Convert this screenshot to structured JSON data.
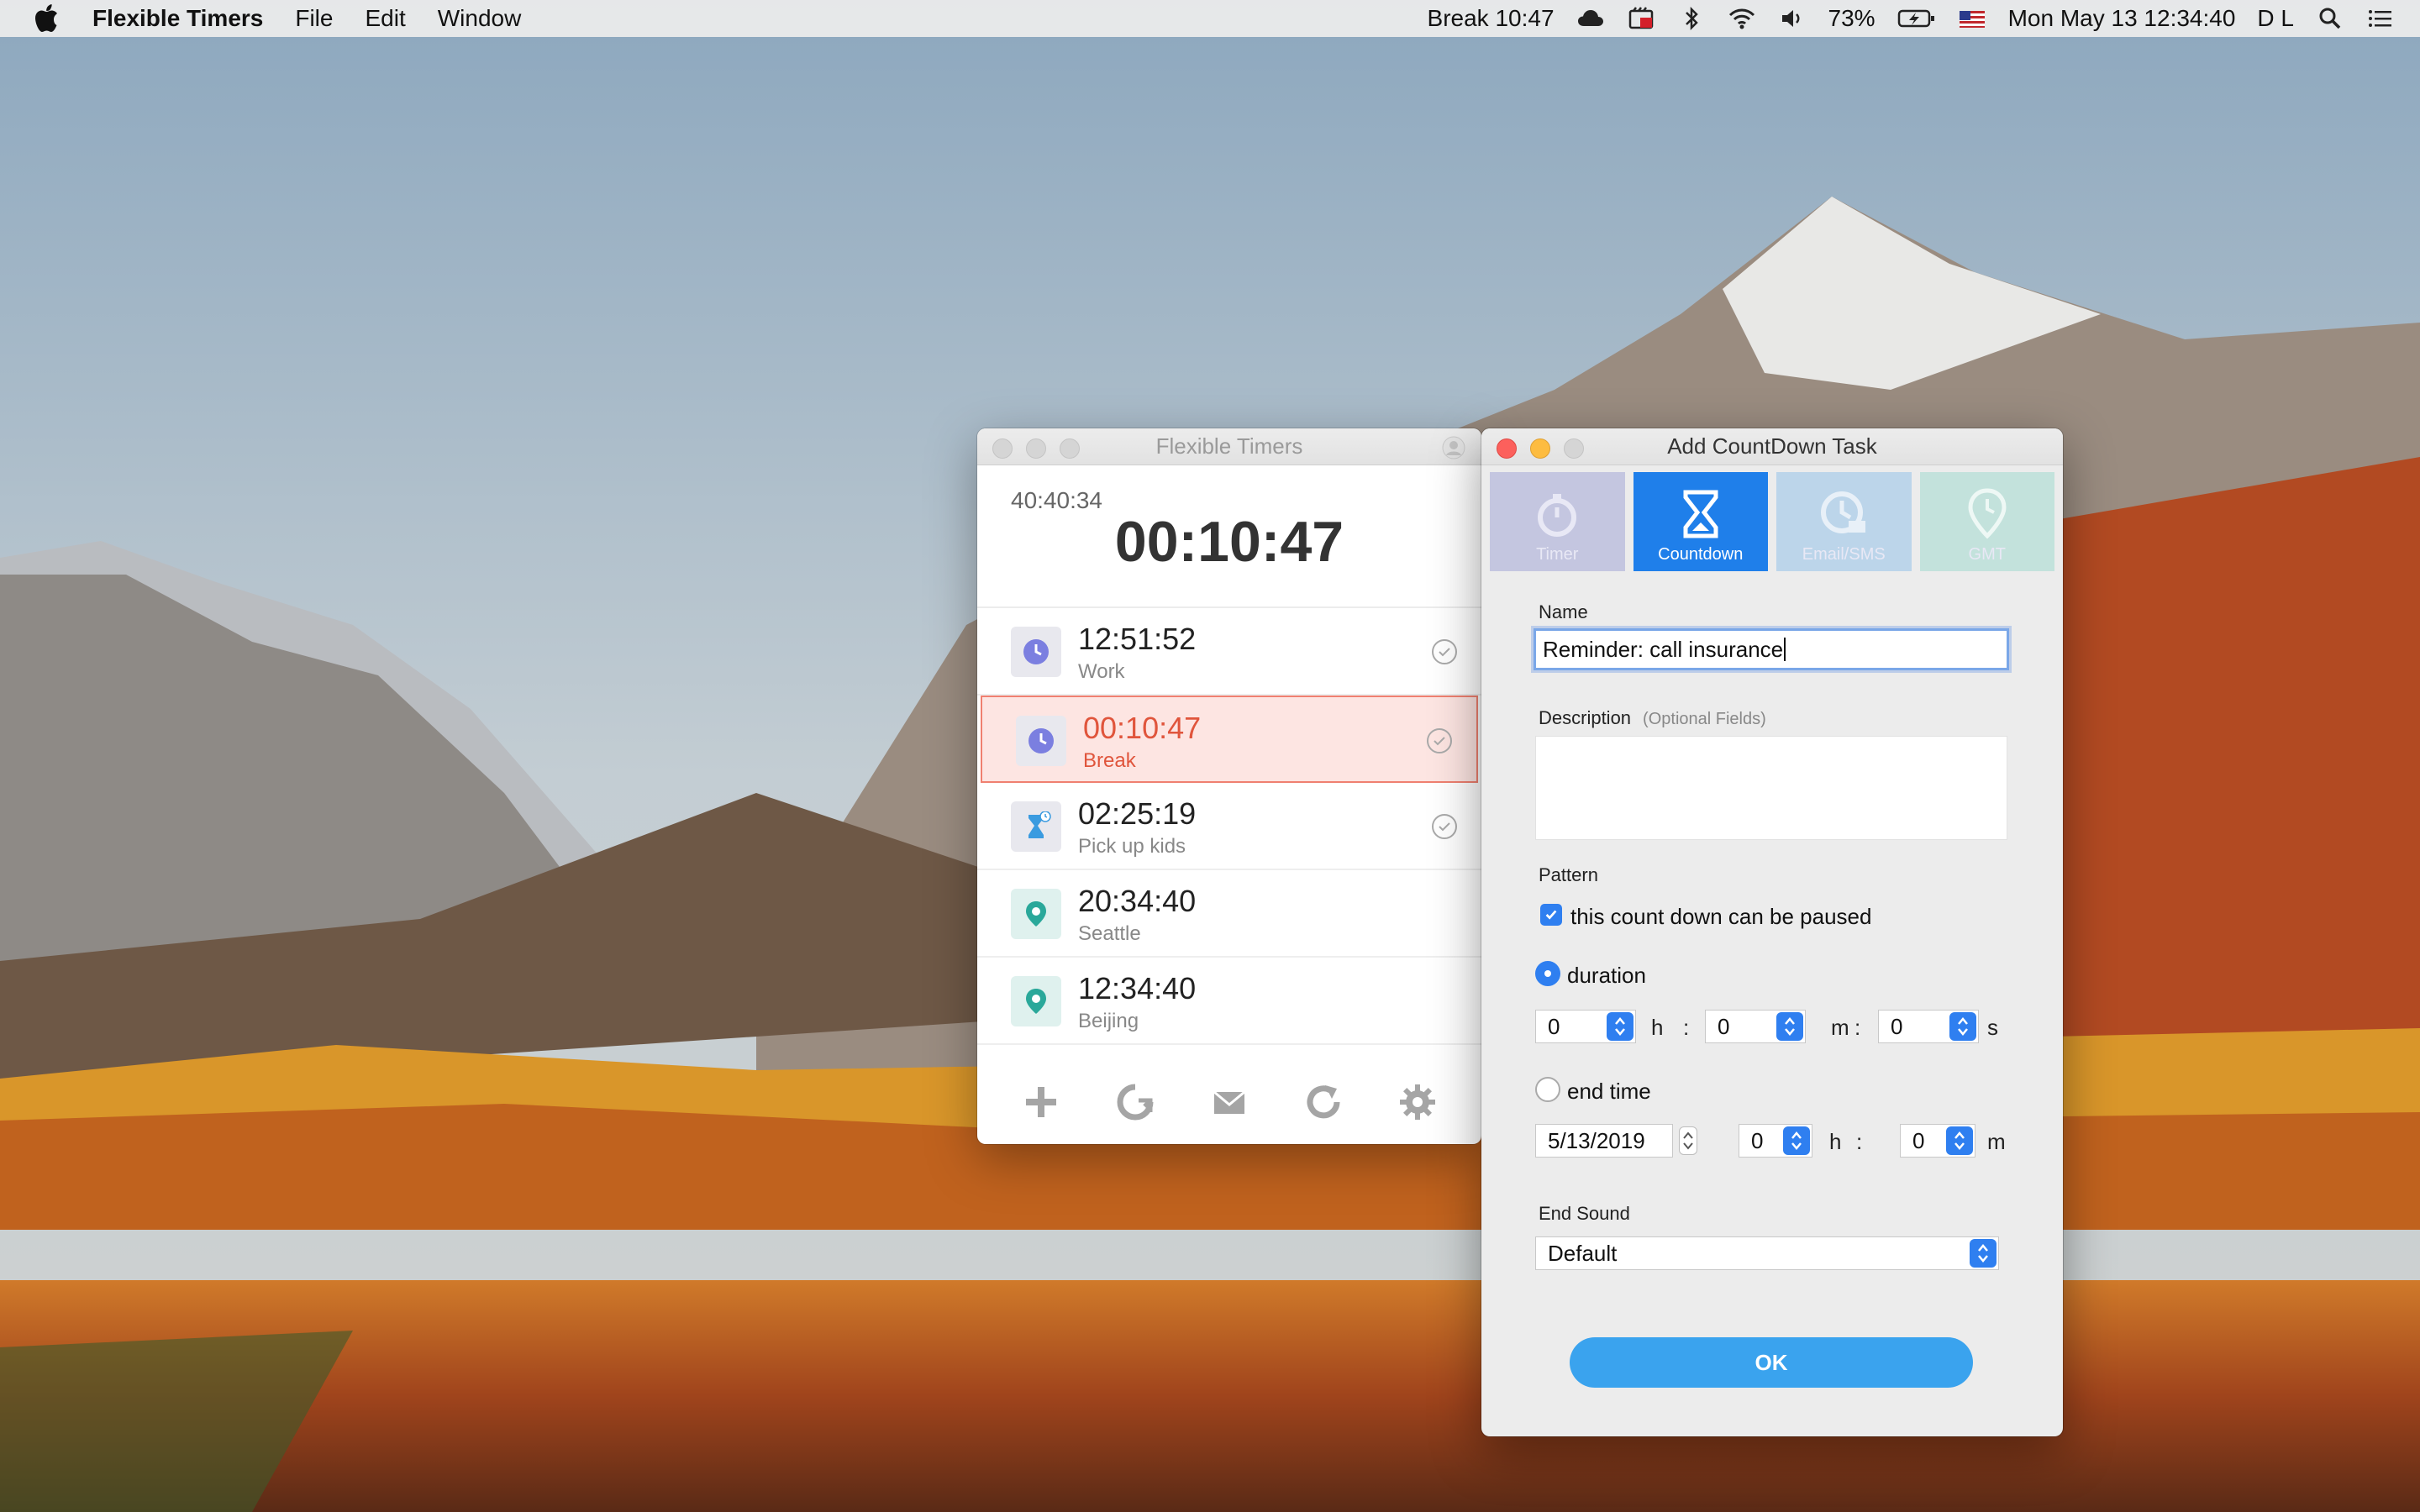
{
  "menubar": {
    "app_name": "Flexible Timers",
    "menus": [
      "File",
      "Edit",
      "Window"
    ],
    "status_timer": "Break 10:47",
    "battery": "73%",
    "datetime": "Mon May 13  12:34:40",
    "user_initials": "D L"
  },
  "main_window": {
    "title": "Flexible Timers",
    "elapsed": "40:40:34",
    "current": "00:10:47",
    "tasks": [
      {
        "time": "12:51:52",
        "label": "Work",
        "icon": "clock-icon",
        "color": "#7b7fe0"
      },
      {
        "time": "00:10:47",
        "label": "Break",
        "icon": "clock-icon",
        "color": "#7b7fe0"
      },
      {
        "time": "02:25:19",
        "label": "Pick up kids",
        "icon": "hourglass-icon",
        "color": "#3a9be0"
      },
      {
        "time": "20:34:40",
        "label": "Seattle",
        "icon": "location-pin-icon",
        "color": "#2aa89a"
      },
      {
        "time": "12:34:40",
        "label": "Beijing",
        "icon": "location-pin-icon",
        "color": "#2aa89a"
      }
    ]
  },
  "dialog": {
    "title": "Add CountDown Task",
    "tabs": [
      "Timer",
      "Countdown",
      "Email/SMS",
      "GMT"
    ],
    "name_label": "Name",
    "name_value": "Reminder: call insurance",
    "description_label": "Description",
    "description_hint": "(Optional Fields)",
    "pattern_label": "Pattern",
    "pausable_label": "this count down can be paused",
    "duration_label": "duration",
    "duration": {
      "h": "0",
      "m": "0",
      "s": "0"
    },
    "units": {
      "h": "h",
      "m": "m",
      "s": "s",
      "colon": ":"
    },
    "end_time_label": "end time",
    "end_date": "5/13/2019",
    "end_h": "0",
    "end_m": "0",
    "end_sound_label": "End Sound",
    "end_sound_value": "Default",
    "ok_label": "OK"
  },
  "colors": {
    "accent": "#2f7ff0",
    "active_task": "#e0553c",
    "ok_button": "#3aa3ee"
  }
}
